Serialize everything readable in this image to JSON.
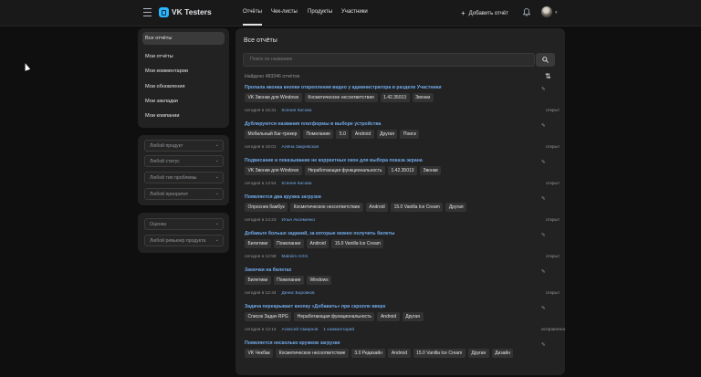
{
  "header": {
    "app_title": "VK Testers",
    "nav": [
      "Отчёты",
      "Чек-листы",
      "Продукты",
      "Участники"
    ],
    "add_report": "Добавить отчёт"
  },
  "sidebar": {
    "items": [
      "Все отчёты",
      "Мои отчёты",
      "Мои комментарии",
      "Мои обновления",
      "Мои закладки",
      "Мои компании"
    ],
    "filters": [
      "Любой продукт",
      "Любой статус",
      "Любой тип проблемы",
      "Любой приоритет"
    ],
    "extra": [
      "Оценка",
      "Любой ревьюер продукта"
    ]
  },
  "main": {
    "title": "Все отчёты",
    "search_placeholder": "Поиск по названию",
    "found": "Найдено 483346 отчётов",
    "reports": [
      {
        "title": "Пропала иконка кнопки открепления видео у администратора в разделе Участники",
        "tags": [
          "VK Звонки для Windows",
          "Косметическое несоответствие",
          "1.42.35013",
          "Звонки"
        ],
        "time": "сегодня в 15:31",
        "author": "Ксения Кисова",
        "comments": "",
        "status": "открыт"
      },
      {
        "title": "Дублируются названия платформы в выборе устройства",
        "tags": [
          "Мобильный Баг-трекер",
          "Помелание",
          "5.0",
          "Android",
          "Другая",
          "Поиск"
        ],
        "time": "сегодня в 15:01",
        "author": "Алёна Закревская",
        "comments": "",
        "status": "открыт"
      },
      {
        "title": "Подвисание и показывание не корректных окон для выбора показа экрана",
        "tags": [
          "VK Звонки для Windows",
          "Неработающая функциональность",
          "1.42.35013",
          "Звонки"
        ],
        "time": "сегодня в 14:54",
        "author": "Ксения Кисова",
        "comments": "",
        "status": "открыт"
      },
      {
        "title": "Появляется два кружка загрузки",
        "tags": [
          "Опросник бамбук",
          "Косметическое несоответствие",
          "Android",
          "15.0 Vanilla Ice Cream",
          "Другая"
        ],
        "time": "сегодня в 14:23",
        "author": "Илья Аксеменко",
        "comments": "",
        "status": "открыт"
      },
      {
        "title": "Добавьте больше заданий, за которые можно получить билеты",
        "tags": [
          "Билетики",
          "Пожелание",
          "Android",
          "15.0 Vanilla Ice Cream"
        ],
        "time": "сегодня в 12:58",
        "author": "Maksim Arzm",
        "comments": "",
        "status": "открыт"
      },
      {
        "title": "Замочки на билетах",
        "tags": [
          "Билетики",
          "Пожелание",
          "Windows"
        ],
        "time": "сегодня в 12:44",
        "author": "Денис Боровков",
        "comments": "",
        "status": "открыт"
      },
      {
        "title": "Задача перекрывает кнопку «Добавить» при скролле вверх",
        "tags": [
          "Список Задач RPG",
          "Неработающая функциональность",
          "Android",
          "Другая"
        ],
        "time": "сегодня в 12:14",
        "author": "Алексей Смирнов",
        "comments": "1 комментарий",
        "status": "исправлено"
      },
      {
        "title": "Появляется несколько кружков загрузки",
        "tags": [
          "VK Чекбак",
          "Косметическое несоответствие",
          "3.0 Редизайн",
          "Android",
          "15.0 Vanilla Ice Cream",
          "Другая",
          "Дизайн"
        ],
        "time": "",
        "author": "",
        "comments": "",
        "status": ""
      }
    ]
  }
}
